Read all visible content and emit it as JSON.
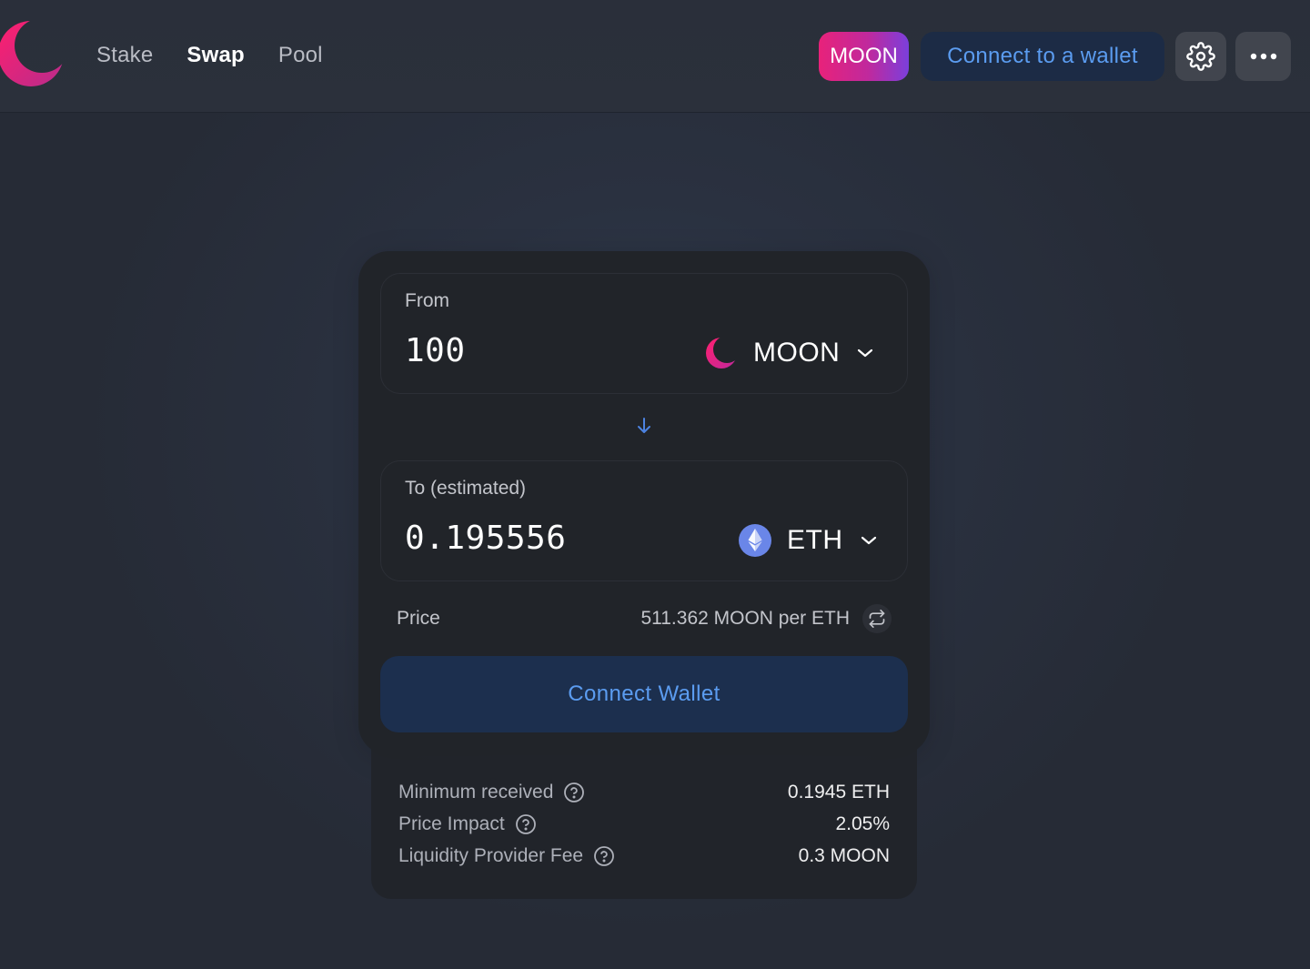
{
  "header": {
    "nav": [
      {
        "label": "Stake"
      },
      {
        "label": "Swap"
      },
      {
        "label": "Pool"
      }
    ],
    "token_badge": "MOON",
    "connect_label": "Connect to a wallet",
    "icons": {
      "settings": "gear-icon",
      "more": "more-horizontal-icon",
      "logo": "crescent-moon-logo"
    }
  },
  "swap": {
    "from": {
      "label": "From",
      "amount": "100",
      "token": "MOON",
      "token_icon": "moon-token-icon"
    },
    "to": {
      "label": "To (estimated)",
      "amount": "0.195556",
      "token": "ETH",
      "token_icon": "eth-token-icon"
    },
    "price": {
      "label": "Price",
      "value": "511.362 MOON per ETH"
    },
    "connect_label": "Connect Wallet"
  },
  "details": [
    {
      "label": "Minimum received",
      "value": "0.1945 ETH"
    },
    {
      "label": "Price Impact",
      "value": "2.05%"
    },
    {
      "label": "Liquidity Provider Fee",
      "value": "0.3 MOON"
    }
  ],
  "colors": {
    "accent_blue": "#5b9cf0",
    "brand_pink": "#e8227a",
    "brand_purple": "#7b3fdc",
    "card_bg": "#212429"
  }
}
